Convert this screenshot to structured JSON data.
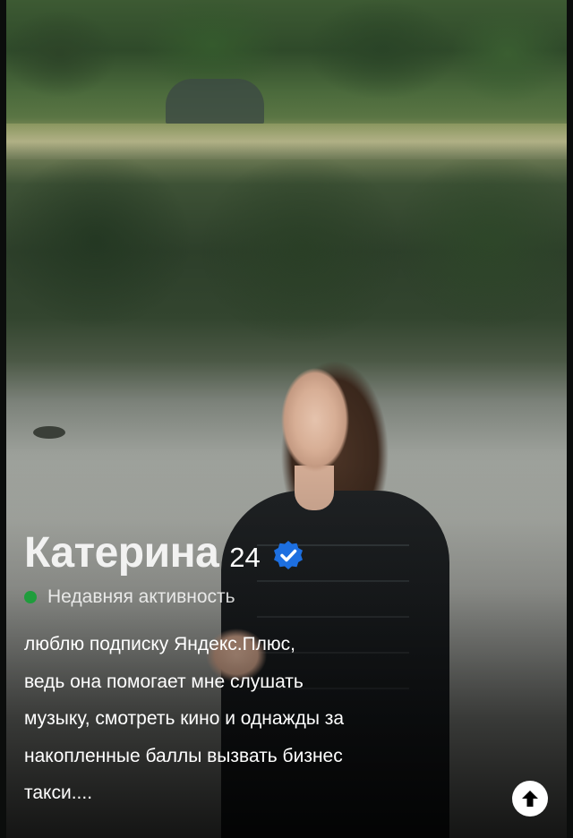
{
  "profile": {
    "name": "Катерина",
    "age": "24",
    "verified_icon": "verified-badge-icon",
    "activity": "Недавняя активность",
    "activity_color": "#1f9d3c",
    "bio_lines": [
      "люблю подписку Яндекс.Плюс,",
      "ведь она помогает мне слушать",
      "музыку, смотреть кино и однажды за",
      "накопленные баллы вызвать бизнес",
      "такси...."
    ]
  },
  "actions": {
    "expand_icon": "arrow-up-icon"
  },
  "colors": {
    "verified_blue": "#1d6fe0",
    "text": "#ffffff"
  }
}
